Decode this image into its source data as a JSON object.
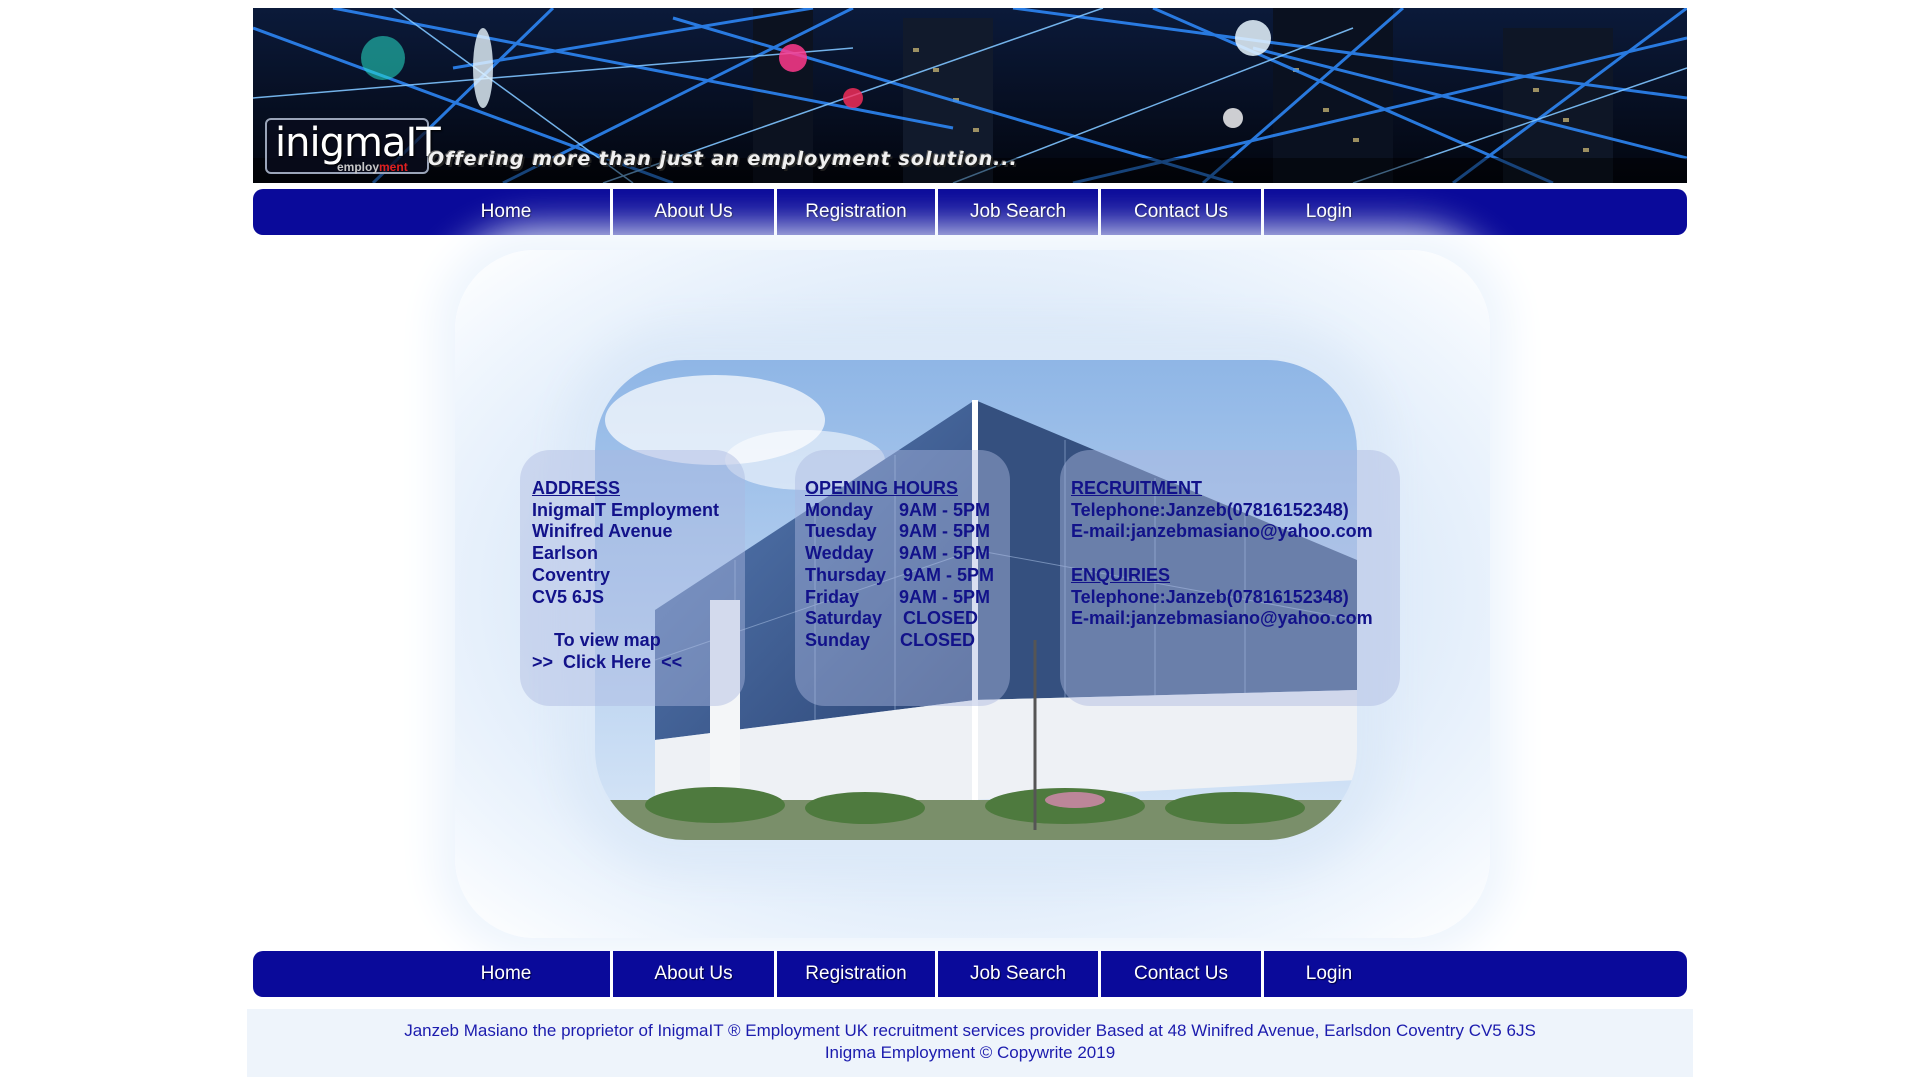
{
  "banner": {
    "logo_main": "inigmaIT",
    "logo_sub_prefix": "employ",
    "logo_sub_suffix": "ment",
    "tagline": "Offering more than just an employment solution..."
  },
  "nav": {
    "items": [
      "Home",
      "About Us",
      "Registration",
      "Job Search",
      "Contact Us",
      "Login"
    ]
  },
  "address": {
    "heading": "ADDRESS",
    "lines": [
      "InigmaIT Employment",
      "Winifred Avenue",
      "Earlson",
      "Coventry",
      "CV5 6JS"
    ],
    "map_label": "To view map",
    "map_link": ">>  Click Here  <<"
  },
  "hours": {
    "heading": "OPENING HOURS",
    "rows": [
      {
        "day": "Monday",
        "time": "9AM - 5PM"
      },
      {
        "day": "Tuesday",
        "time": "9AM - 5PM"
      },
      {
        "day": "Wedday",
        "time": "9AM - 5PM"
      },
      {
        "day": "Thursday",
        "time": "9AM - 5PM"
      },
      {
        "day": "Friday",
        "time": "9AM - 5PM"
      },
      {
        "day": "Saturday",
        "time": "CLOSED"
      },
      {
        "day": "Sunday",
        "time": "CLOSED"
      }
    ]
  },
  "recruitment": {
    "heading": "RECRUITMENT",
    "telephone": "Telephone:Janzeb(07816152348)",
    "email": "E-mail:janzebmasiano@yahoo.com"
  },
  "enquiries": {
    "heading": "ENQUIRIES",
    "telephone": "Telephone:Janzeb(07816152348)",
    "email": "E-mail:janzebmasiano@yahoo.com"
  },
  "footer": {
    "line1": "Janzeb Masiano the proprietor of InigmaIT ® Employment UK recruitment services provider Based at 48 Winifred Avenue, Earlsdon Coventry CV5 6JS",
    "line2": "Inigma Employment © Copywrite 2019"
  },
  "colors": {
    "nav_bg": "#0a0a9a",
    "info_text": "#12128a",
    "footer_text": "#1c1cae"
  }
}
